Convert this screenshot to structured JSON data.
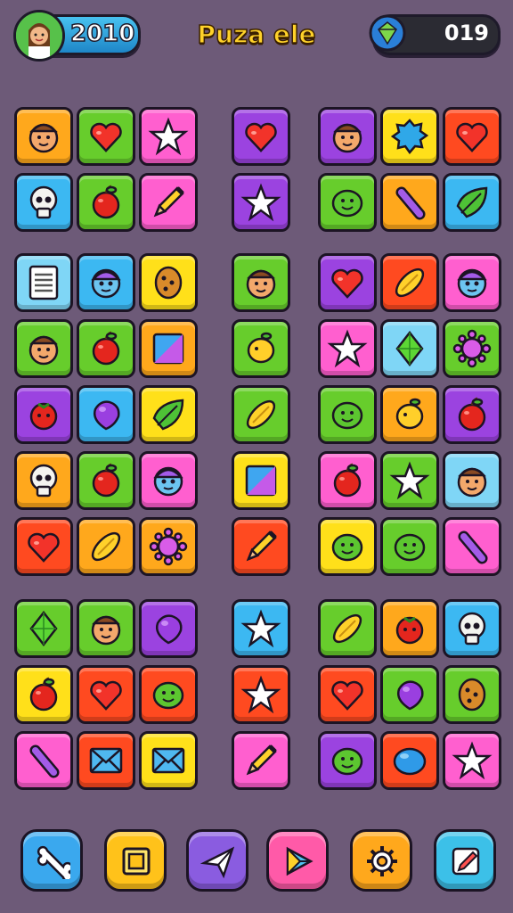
{
  "header": {
    "score": "2010",
    "title": "Puza ele",
    "gems": "019"
  },
  "colors": {
    "orange": "#ffa81c",
    "green": "#67cd2c",
    "pink": "#ff5fcf",
    "purple": "#9b43e0",
    "yellow": "#ffe01a",
    "red": "#ff4a20",
    "blue": "#3cb8f2",
    "lightblue": "#7fd6f6"
  },
  "groups": [
    {
      "name": "top-left",
      "tiles": [
        [
          "orange",
          "face"
        ],
        [
          "green",
          "heart"
        ],
        [
          "pink",
          "star"
        ],
        [
          "blue",
          "skull"
        ],
        [
          "green",
          "apple"
        ],
        [
          "pink",
          "pencil"
        ]
      ]
    },
    {
      "name": "top-mid",
      "tiles": [
        [
          "purple",
          "heart"
        ],
        [
          "purple",
          "star"
        ]
      ]
    },
    {
      "name": "top-right",
      "tiles": [
        [
          "purple",
          "face"
        ],
        [
          "yellow",
          "blob"
        ],
        [
          "red",
          "heart"
        ],
        [
          "green",
          "smile"
        ],
        [
          "orange",
          "stick"
        ],
        [
          "blue",
          "leaf"
        ]
      ]
    },
    {
      "name": "mid-left",
      "tiles": [
        [
          "lightblue",
          "note"
        ],
        [
          "blue",
          "robot"
        ],
        [
          "yellow",
          "cookie"
        ],
        [
          "green",
          "face"
        ],
        [
          "green",
          "apple"
        ],
        [
          "orange",
          "square"
        ],
        [
          "purple",
          "berry"
        ],
        [
          "blue",
          "grape"
        ],
        [
          "yellow",
          "leaf"
        ],
        [
          "orange",
          "skull"
        ],
        [
          "green",
          "apple"
        ],
        [
          "pink",
          "robot"
        ],
        [
          "red",
          "heart"
        ],
        [
          "orange",
          "bean"
        ],
        [
          "orange",
          "virus"
        ]
      ]
    },
    {
      "name": "mid-mid",
      "tiles": [
        [
          "green",
          "face"
        ],
        [
          "green",
          "lemon"
        ],
        [
          "green",
          "bean"
        ],
        [
          "yellow",
          "square"
        ],
        [
          "red",
          "pencil"
        ]
      ]
    },
    {
      "name": "mid-right",
      "tiles": [
        [
          "purple",
          "heart"
        ],
        [
          "red",
          "bean"
        ],
        [
          "pink",
          "robot"
        ],
        [
          "pink",
          "star"
        ],
        [
          "lightblue",
          "gem"
        ],
        [
          "green",
          "virus"
        ],
        [
          "green",
          "smile"
        ],
        [
          "orange",
          "lemon"
        ],
        [
          "purple",
          "apple"
        ],
        [
          "pink",
          "apple"
        ],
        [
          "green",
          "star"
        ],
        [
          "lightblue",
          "face"
        ],
        [
          "yellow",
          "smile"
        ],
        [
          "green",
          "smile"
        ],
        [
          "pink",
          "stick"
        ]
      ]
    },
    {
      "name": "bot-left",
      "tiles": [
        [
          "green",
          "gem"
        ],
        [
          "green",
          "face"
        ],
        [
          "purple",
          "grape"
        ],
        [
          "yellow",
          "apple"
        ],
        [
          "red",
          "heart"
        ],
        [
          "red",
          "smile"
        ],
        [
          "pink",
          "stick"
        ],
        [
          "red",
          "mail"
        ],
        [
          "yellow",
          "mail"
        ]
      ]
    },
    {
      "name": "bot-mid",
      "tiles": [
        [
          "blue",
          "star"
        ],
        [
          "red",
          "star"
        ],
        [
          "pink",
          "pencil"
        ]
      ]
    },
    {
      "name": "bot-right",
      "tiles": [
        [
          "green",
          "bean"
        ],
        [
          "orange",
          "berry"
        ],
        [
          "blue",
          "skull"
        ],
        [
          "red",
          "heart"
        ],
        [
          "green",
          "grape"
        ],
        [
          "green",
          "cookie"
        ],
        [
          "purple",
          "smile"
        ],
        [
          "red",
          "ball"
        ],
        [
          "pink",
          "star"
        ]
      ]
    }
  ],
  "toolbar": [
    {
      "name": "bone-button",
      "color": "#3aa8ee",
      "icon": "bone"
    },
    {
      "name": "frame-button",
      "color": "#ffc21a",
      "icon": "frame"
    },
    {
      "name": "send-button",
      "color": "#8a5ce0",
      "icon": "plane"
    },
    {
      "name": "play-button",
      "color": "#ff5aa8",
      "icon": "play"
    },
    {
      "name": "settings-button",
      "color": "#ffa81c",
      "icon": "gear"
    },
    {
      "name": "edit-button",
      "color": "#3cc0e8",
      "icon": "edit"
    }
  ]
}
